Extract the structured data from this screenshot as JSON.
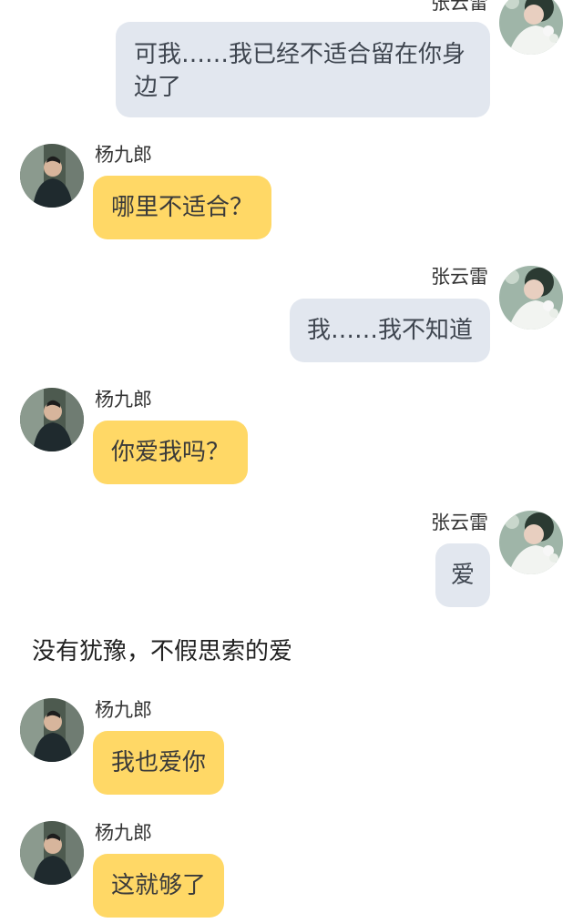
{
  "characters": {
    "left": {
      "name": "杨九郎"
    },
    "right": {
      "name": "张云雷"
    }
  },
  "messages": [
    {
      "side": "right",
      "name": "张云雷",
      "text": "可我……我已经不适合留在你身边了"
    },
    {
      "side": "left",
      "name": "杨九郎",
      "text": "哪里不适合？"
    },
    {
      "side": "right",
      "name": "张云雷",
      "text": "我……我不知道"
    },
    {
      "side": "left",
      "name": "杨九郎",
      "text": "你爱我吗？"
    },
    {
      "side": "right",
      "name": "张云雷",
      "text": "爱"
    },
    {
      "side": "narration",
      "text": "没有犹豫，不假思索的爱"
    },
    {
      "side": "left",
      "name": "杨九郎",
      "text": "我也爱你"
    },
    {
      "side": "left",
      "name": "杨九郎",
      "text": "这就够了"
    }
  ],
  "colors": {
    "left_bubble": "#ffd866",
    "right_bubble": "#e2e7ef",
    "background": "#ffffff"
  },
  "icons": {
    "left_avatar": "avatar-yangjiulang-icon",
    "right_avatar": "avatar-zhangyunlei-icon"
  }
}
